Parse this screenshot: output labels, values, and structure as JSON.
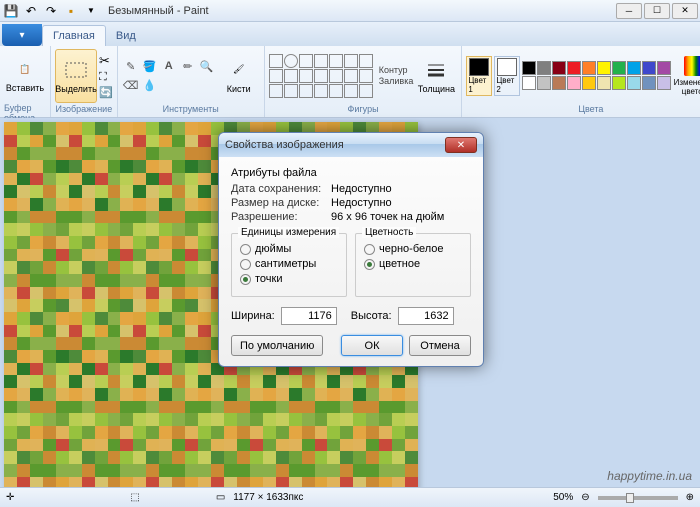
{
  "title": "Безымянный - Paint",
  "tabs": {
    "home": "Главная",
    "view": "Вид"
  },
  "ribbon": {
    "clipboard": {
      "paste": "Вставить",
      "label": "Буфер обмена"
    },
    "image": {
      "select": "Выделить",
      "label": "Изображение"
    },
    "tools": {
      "brushes": "Кисти",
      "label": "Инструменты"
    },
    "shapes": {
      "outline": "Контур",
      "fill": "Заливка",
      "thickness": "Толщина",
      "label": "Фигуры"
    },
    "colors": {
      "c1": "Цвет 1",
      "c2": "Цвет 2",
      "edit": "Изменение цветов",
      "label": "Цвета"
    }
  },
  "dialog": {
    "title": "Свойства изображения",
    "attr_header": "Атрибуты файла",
    "saved_label": "Дата сохранения:",
    "saved_val": "Недоступно",
    "disk_label": "Размер на диске:",
    "disk_val": "Недоступно",
    "res_label": "Разрешение:",
    "res_val": "96 x 96 точек на дюйм",
    "units_legend": "Единицы измерения",
    "unit_inches": "дюймы",
    "unit_cm": "сантиметры",
    "unit_px": "точки",
    "color_legend": "Цветность",
    "color_bw": "черно-белое",
    "color_color": "цветное",
    "width_label": "Ширина:",
    "width_val": "1176",
    "height_label": "Высота:",
    "height_val": "1632",
    "default_btn": "По умолчанию",
    "ok_btn": "ОК",
    "cancel_btn": "Отмена"
  },
  "status": {
    "dims": "1177 × 1633пкс",
    "zoom": "50%"
  },
  "watermark": "happytime.in.ua",
  "palette": [
    "#000",
    "#7f7f7f",
    "#880015",
    "#ed1c24",
    "#ff7f27",
    "#fff200",
    "#22b14c",
    "#00a2e8",
    "#3f48cc",
    "#a349a4",
    "#fff",
    "#c3c3c3",
    "#b97a57",
    "#ffaec9",
    "#ffc90e",
    "#efe4b0",
    "#b5e61d",
    "#99d9ea",
    "#7092be",
    "#c8bfe7"
  ],
  "pixcolors": [
    "#dfa43b",
    "#e0b35a",
    "#c7ce5e",
    "#97c23e",
    "#5a9a2e",
    "#2b7a2b",
    "#4e8b3a",
    "#c94a3a",
    "#d6c26b",
    "#8ab04a",
    "#71a33b",
    "#b9ce53",
    "#e4a642",
    "#e0b254",
    "#cb8a34"
  ]
}
